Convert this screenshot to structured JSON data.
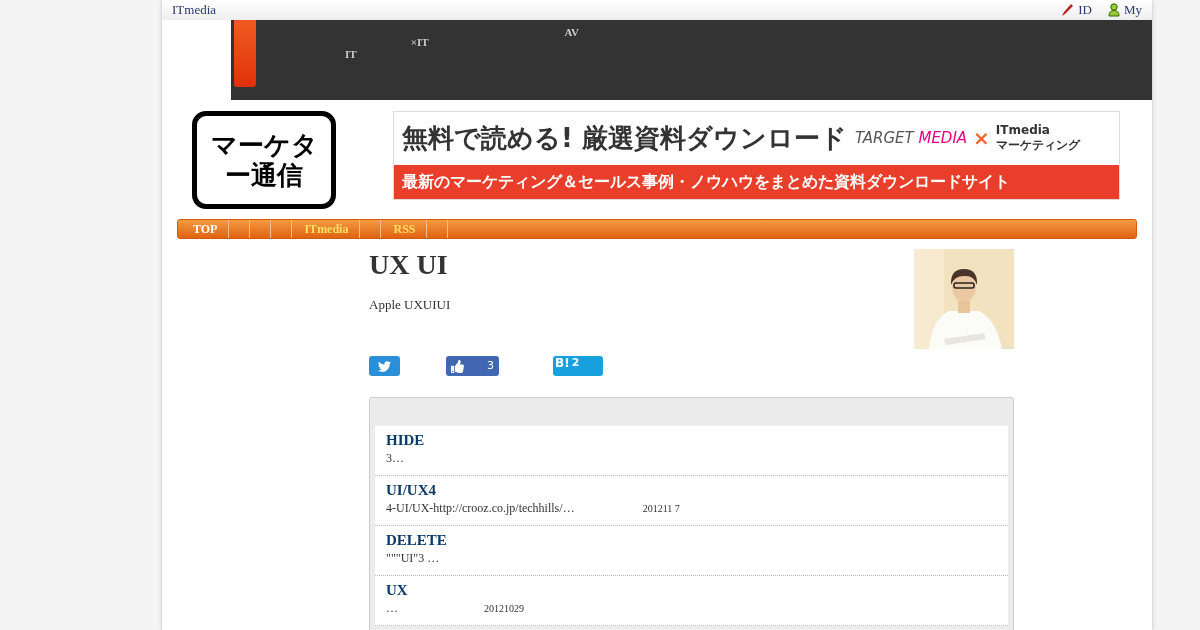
{
  "top_bar": {
    "site": "ITmedia",
    "links": [
      {
        "label": "ID",
        "kind": "pen"
      },
      {
        "label": "My",
        "kind": "user"
      }
    ]
  },
  "dark_nav": {
    "items": [
      {
        "label": "IT"
      },
      {
        "label": "×IT"
      },
      {
        "label": "AV"
      }
    ]
  },
  "logo": {
    "text": "マーケター通信"
  },
  "banner": {
    "headline": "無料で読める! 厳選資料ダウンロード",
    "brand_left": "TARGET",
    "brand_mid": "MEDIA",
    "cross": "×",
    "brand_right_top": "ITmedia",
    "brand_right_bottom": "マーケティング",
    "tagline": "最新のマーケティング＆セールス事例・ノウハウをまとめた資料ダウンロードサイト"
  },
  "nav": {
    "items": [
      {
        "label": "TOP"
      },
      {
        "label": "ITmedia"
      },
      {
        "label": "RSS"
      }
    ]
  },
  "article": {
    "title": "UX UI",
    "description": "Apple UXUIUI"
  },
  "share": [
    {
      "kind": "twitter"
    },
    {
      "kind": "like",
      "count": "3"
    },
    {
      "kind": "hatena",
      "label": "B!",
      "count": "2"
    }
  ],
  "entries": [
    {
      "title": "HIDE",
      "summary": "3…"
    },
    {
      "title": "UI/UX4",
      "summary": "4-UI/UX-http://crooz.co.jp/techhills/…",
      "date": "201211 7"
    },
    {
      "title": "DELETE",
      "summary": "\"\"\"UI\"3 …"
    },
    {
      "title": "UX",
      "summary": "…",
      "date": "20121029"
    }
  ]
}
